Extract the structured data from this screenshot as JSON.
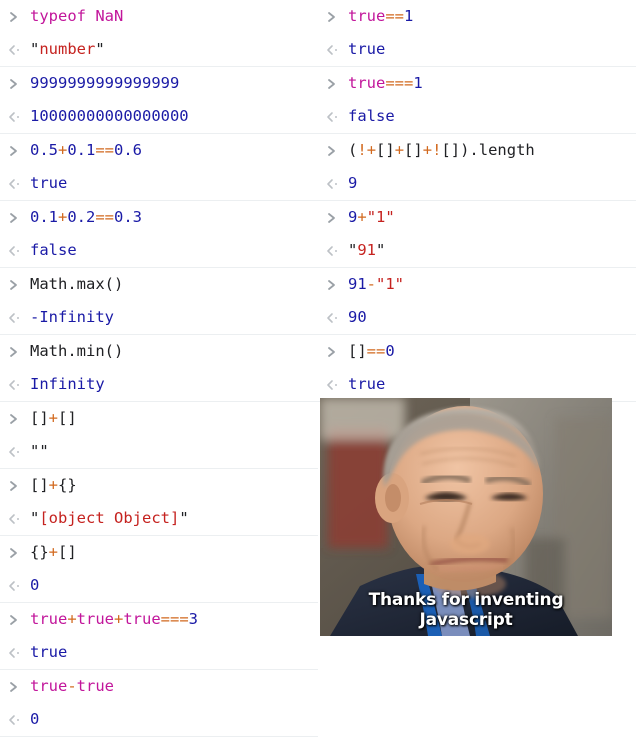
{
  "console": {
    "prompt_icon": "chevron-right-icon",
    "output_icon": "chevron-left-dot-icon",
    "columns": [
      {
        "name": "left",
        "entries": [
          {
            "input_tokens": [
              {
                "t": "typeof ",
                "c": "kw"
              },
              {
                "t": "NaN",
                "c": "kw"
              }
            ],
            "input_text": "typeof NaN",
            "output_tokens": [
              {
                "t": "\"",
                "c": "quote"
              },
              {
                "t": "number",
                "c": "str"
              },
              {
                "t": "\"",
                "c": "quote"
              }
            ],
            "output_text": "\"number\""
          },
          {
            "input_tokens": [
              {
                "t": "9999999999999999",
                "c": "num"
              }
            ],
            "input_text": "9999999999999999",
            "output_tokens": [
              {
                "t": "10000000000000000",
                "c": "val"
              }
            ],
            "output_text": "10000000000000000"
          },
          {
            "input_tokens": [
              {
                "t": "0.5",
                "c": "num"
              },
              {
                "t": "+",
                "c": "op"
              },
              {
                "t": "0.1",
                "c": "num"
              },
              {
                "t": "==",
                "c": "op"
              },
              {
                "t": "0.6",
                "c": "num"
              }
            ],
            "input_text": "0.5+0.1==0.6",
            "output_tokens": [
              {
                "t": "true",
                "c": "val"
              }
            ],
            "output_text": "true"
          },
          {
            "input_tokens": [
              {
                "t": "0.1",
                "c": "num"
              },
              {
                "t": "+",
                "c": "op"
              },
              {
                "t": "0.2",
                "c": "num"
              },
              {
                "t": "==",
                "c": "op"
              },
              {
                "t": "0.3",
                "c": "num"
              }
            ],
            "input_text": "0.1+0.2==0.3",
            "output_tokens": [
              {
                "t": "false",
                "c": "val"
              }
            ],
            "output_text": "false"
          },
          {
            "input_tokens": [
              {
                "t": "Math.max()",
                "c": "pl"
              }
            ],
            "input_text": "Math.max()",
            "output_tokens": [
              {
                "t": "-Infinity",
                "c": "val"
              }
            ],
            "output_text": "-Infinity"
          },
          {
            "input_tokens": [
              {
                "t": "Math.min()",
                "c": "pl"
              }
            ],
            "input_text": "Math.min()",
            "output_tokens": [
              {
                "t": "Infinity",
                "c": "val"
              }
            ],
            "output_text": "Infinity"
          },
          {
            "input_tokens": [
              {
                "t": "[]",
                "c": "pl"
              },
              {
                "t": "+",
                "c": "op"
              },
              {
                "t": "[]",
                "c": "pl"
              }
            ],
            "input_text": "[]+[]",
            "output_tokens": [
              {
                "t": "\"\"",
                "c": "quote"
              }
            ],
            "output_text": "\"\""
          },
          {
            "input_tokens": [
              {
                "t": "[]",
                "c": "pl"
              },
              {
                "t": "+",
                "c": "op"
              },
              {
                "t": "{}",
                "c": "pl"
              }
            ],
            "input_text": "[]+{}",
            "output_tokens": [
              {
                "t": "\"",
                "c": "quote"
              },
              {
                "t": "[object Object]",
                "c": "str"
              },
              {
                "t": "\"",
                "c": "quote"
              }
            ],
            "output_text": "\"[object Object]\""
          },
          {
            "input_tokens": [
              {
                "t": "{}",
                "c": "pl"
              },
              {
                "t": "+",
                "c": "op"
              },
              {
                "t": "[]",
                "c": "pl"
              }
            ],
            "input_text": "{}+[]",
            "output_tokens": [
              {
                "t": "0",
                "c": "val"
              }
            ],
            "output_text": "0"
          },
          {
            "input_tokens": [
              {
                "t": "true",
                "c": "kw"
              },
              {
                "t": "+",
                "c": "op"
              },
              {
                "t": "true",
                "c": "kw"
              },
              {
                "t": "+",
                "c": "op"
              },
              {
                "t": "true",
                "c": "kw"
              },
              {
                "t": "===",
                "c": "op"
              },
              {
                "t": "3",
                "c": "num"
              }
            ],
            "input_text": "true+true+true===3",
            "output_tokens": [
              {
                "t": "true",
                "c": "val"
              }
            ],
            "output_text": "true"
          },
          {
            "input_tokens": [
              {
                "t": "true",
                "c": "kw"
              },
              {
                "t": "-",
                "c": "op"
              },
              {
                "t": "true",
                "c": "kw"
              }
            ],
            "input_text": "true-true",
            "output_tokens": [
              {
                "t": "0",
                "c": "val"
              }
            ],
            "output_text": "0"
          }
        ]
      },
      {
        "name": "right",
        "entries": [
          {
            "input_tokens": [
              {
                "t": "true",
                "c": "kw"
              },
              {
                "t": "==",
                "c": "op"
              },
              {
                "t": "1",
                "c": "num"
              }
            ],
            "input_text": "true==1",
            "output_tokens": [
              {
                "t": "true",
                "c": "val"
              }
            ],
            "output_text": "true"
          },
          {
            "input_tokens": [
              {
                "t": "true",
                "c": "kw"
              },
              {
                "t": "===",
                "c": "op"
              },
              {
                "t": "1",
                "c": "num"
              }
            ],
            "input_text": "true===1",
            "output_tokens": [
              {
                "t": "false",
                "c": "val"
              }
            ],
            "output_text": "false"
          },
          {
            "input_tokens": [
              {
                "t": "(",
                "c": "pl"
              },
              {
                "t": "!",
                "c": "op"
              },
              {
                "t": "+",
                "c": "op"
              },
              {
                "t": "[]",
                "c": "pl"
              },
              {
                "t": "+",
                "c": "op"
              },
              {
                "t": "[]",
                "c": "pl"
              },
              {
                "t": "+",
                "c": "op"
              },
              {
                "t": "!",
                "c": "op"
              },
              {
                "t": "[]",
                "c": "pl"
              },
              {
                "t": ").length",
                "c": "pl"
              }
            ],
            "input_text": "(!+[]+[]+![]).length",
            "output_tokens": [
              {
                "t": "9",
                "c": "val"
              }
            ],
            "output_text": "9"
          },
          {
            "input_tokens": [
              {
                "t": "9",
                "c": "num"
              },
              {
                "t": "+",
                "c": "op"
              },
              {
                "t": "\"",
                "c": "str"
              },
              {
                "t": "1",
                "c": "str"
              },
              {
                "t": "\"",
                "c": "str"
              }
            ],
            "input_text": "9+\"1\"",
            "output_tokens": [
              {
                "t": "\"",
                "c": "quote"
              },
              {
                "t": "91",
                "c": "str"
              },
              {
                "t": "\"",
                "c": "quote"
              }
            ],
            "output_text": "\"91\""
          },
          {
            "input_tokens": [
              {
                "t": "91",
                "c": "num"
              },
              {
                "t": "-",
                "c": "op"
              },
              {
                "t": "\"1\"",
                "c": "str"
              }
            ],
            "input_text": "91-\"1\"",
            "output_tokens": [
              {
                "t": "90",
                "c": "val"
              }
            ],
            "output_text": "90"
          },
          {
            "input_tokens": [
              {
                "t": "[]",
                "c": "pl"
              },
              {
                "t": "==",
                "c": "op"
              },
              {
                "t": "0",
                "c": "num"
              }
            ],
            "input_text": "[]==0",
            "output_tokens": [
              {
                "t": "true",
                "c": "val"
              }
            ],
            "output_text": "true"
          }
        ]
      }
    ]
  },
  "photo": {
    "caption": "Thanks for inventing Javascript",
    "alt": "smiling-man-portrait"
  },
  "colors": {
    "keyword": "#c2169b",
    "number": "#1a1aa6",
    "operator": "#d2691e",
    "string": "#c5221f",
    "plain": "#202124",
    "gutter": "#9aa0a6",
    "divider": "#eceff1"
  }
}
